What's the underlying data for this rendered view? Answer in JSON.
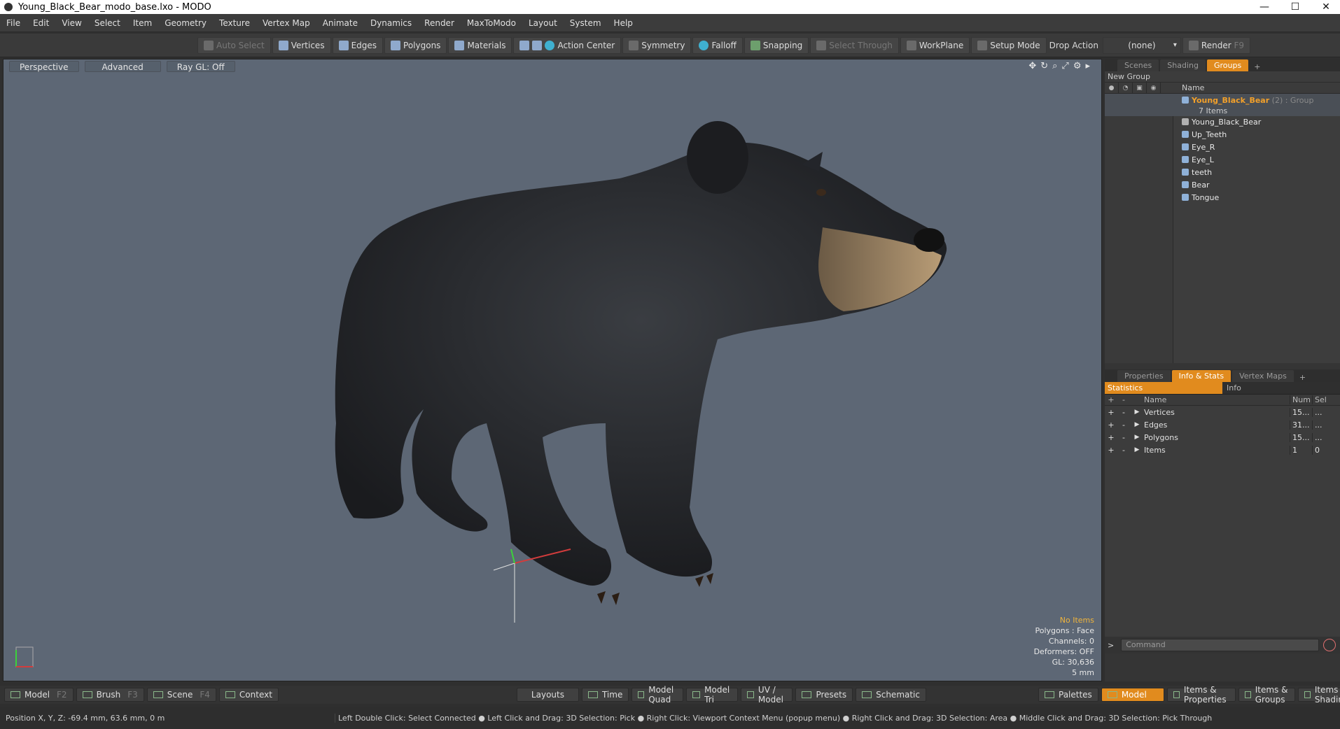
{
  "window": {
    "title": "Young_Black_Bear_modo_base.lxo - MODO",
    "minimize": "—",
    "maximize": "☐",
    "close": "✕"
  },
  "menu": [
    "File",
    "Edit",
    "View",
    "Select",
    "Item",
    "Geometry",
    "Texture",
    "Vertex Map",
    "Animate",
    "Dynamics",
    "Render",
    "MaxToModo",
    "Layout",
    "System",
    "Help"
  ],
  "toolbar": {
    "auto_select": "Auto Select",
    "vertices": "Vertices",
    "edges": "Edges",
    "polygons": "Polygons",
    "materials": "Materials",
    "action_center": "Action Center",
    "symmetry": "Symmetry",
    "falloff": "Falloff",
    "snapping": "Snapping",
    "select_through": "Select Through",
    "workplane": "WorkPlane",
    "setup_mode": "Setup Mode",
    "drop_action": "Drop Action",
    "drop_value": "(none)",
    "render": "Render",
    "render_key": "F9"
  },
  "viewport": {
    "tabs": [
      "Perspective",
      "Advanced",
      "Ray GL: Off"
    ],
    "info": {
      "items": "No Items",
      "polygons": "Polygons : Face",
      "channels": "Channels: 0",
      "deformers": "Deformers: OFF",
      "gl": "GL: 30,636",
      "scale": "5 mm"
    }
  },
  "groups_panel": {
    "tabs": [
      "Scenes",
      "Shading",
      "Groups"
    ],
    "active_tab": "Groups",
    "new_group": "New Group",
    "column_name": "Name",
    "group": {
      "name": "Young_Black_Bear",
      "suffix": "(2) : Group",
      "count": "7 Items"
    },
    "items": [
      "Young_Black_Bear",
      "Up_Teeth",
      "Eye_R",
      "Eye_L",
      "teeth",
      "Bear",
      "Tongue"
    ]
  },
  "stats_panel": {
    "tabs": [
      "Properties",
      "Info & Stats",
      "Vertex Maps"
    ],
    "active_tab": "Info & Stats",
    "sub_tabs": [
      "Statistics",
      "Info"
    ],
    "headers": {
      "name": "Name",
      "num": "Num",
      "sel": "Sel"
    },
    "rows": [
      {
        "name": "Vertices",
        "num": "15...",
        "sel": "..."
      },
      {
        "name": "Edges",
        "num": "31...",
        "sel": "..."
      },
      {
        "name": "Polygons",
        "num": "15...",
        "sel": "..."
      },
      {
        "name": "Items",
        "num": "1",
        "sel": "0"
      }
    ],
    "command_placeholder": "Command"
  },
  "bottom_bar": {
    "left": [
      {
        "label": "Model",
        "key": "F2"
      },
      {
        "label": "Brush",
        "key": "F3"
      },
      {
        "label": "Scene",
        "key": "F4"
      },
      {
        "label": "Context",
        "key": ""
      }
    ],
    "center": [
      "Layouts",
      "Time",
      "Model Quad",
      "Model Tri",
      "UV / Model",
      "Presets",
      "Schematic"
    ],
    "palettes": "Palettes",
    "model": "Model",
    "right": [
      "Items & Properties",
      "Items & Groups",
      "Items & Shading"
    ]
  },
  "status": {
    "position": "Position X, Y, Z:  -69.4 mm, 63.6 mm, 0 m",
    "hint": "Left Double Click: Select Connected ● Left Click and Drag: 3D Selection: Pick ● Right Click: Viewport Context Menu (popup menu) ● Right Click and Drag: 3D Selection: Area ● Middle Click and Drag: 3D Selection: Pick Through"
  },
  "colors": {
    "accent": "#e18b1e",
    "viewport_bg": "#5d6775",
    "panel_bg": "#353535"
  }
}
